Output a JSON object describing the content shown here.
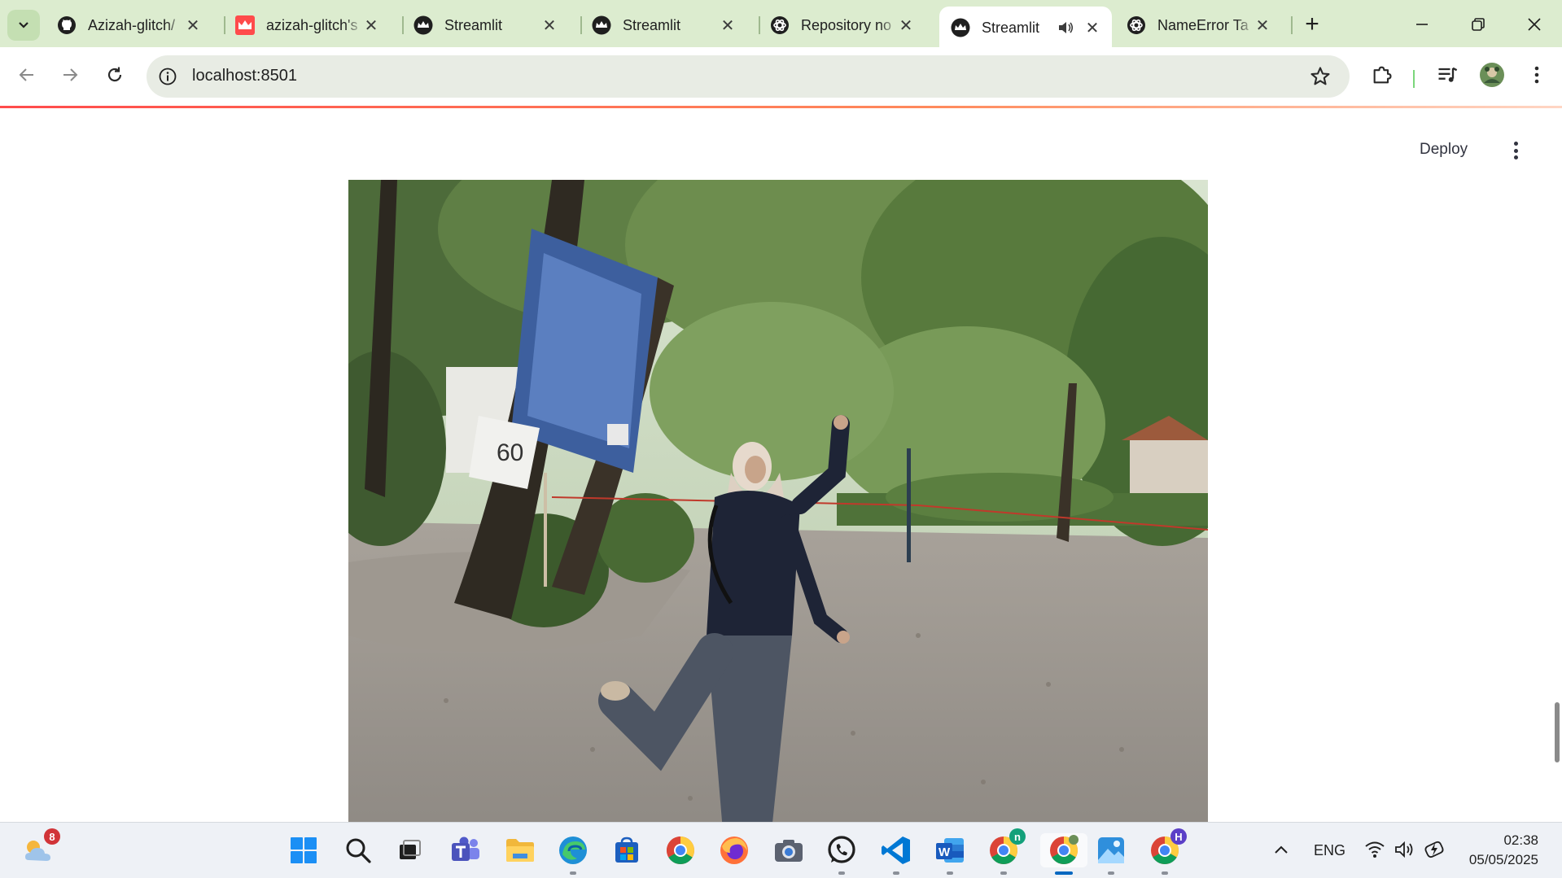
{
  "browser": {
    "tabs": [
      {
        "label": "Azizah-glitch/",
        "icon": "github-icon"
      },
      {
        "label": "azizah-glitch's",
        "icon": "streamlit-crown-icon"
      },
      {
        "label": "Streamlit",
        "icon": "streamlit-icon"
      },
      {
        "label": "Streamlit",
        "icon": "streamlit-icon"
      },
      {
        "label": "Repository no",
        "icon": "openai-icon"
      },
      {
        "label": "Streamlit",
        "icon": "streamlit-icon",
        "active": true,
        "audio": true
      },
      {
        "label": "NameError Ta",
        "icon": "openai-icon"
      }
    ],
    "address": "localhost:8501"
  },
  "app": {
    "deploy_label": "Deploy"
  },
  "taskbar": {
    "weather_badge": "8",
    "teams_badge": "n",
    "chrome_profile_badge": "H",
    "language": "ENG",
    "time": "02:38",
    "date": "05/05/2025"
  },
  "colors": {
    "tabstrip": "#dceccf",
    "omnibox": "#e8ece4",
    "streamlit_accent": "#ff4b4b",
    "taskbar": "#eef1f6"
  }
}
